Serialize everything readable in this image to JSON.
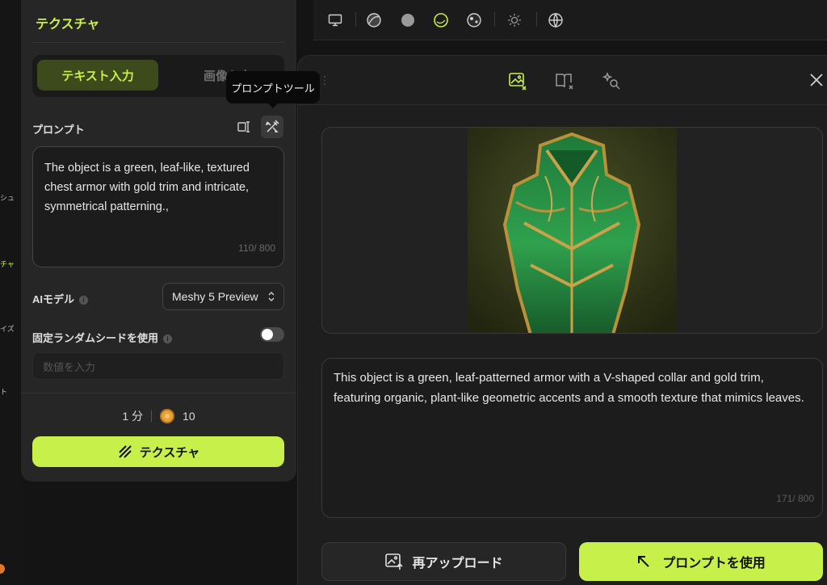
{
  "leftnav": {
    "fragments": [
      {
        "text": "シュ",
        "active": false
      },
      {
        "text": "チャ",
        "active": true
      },
      {
        "text": "イズ",
        "active": false
      },
      {
        "text": "ト",
        "active": false
      }
    ]
  },
  "panel": {
    "title": "テクスチャ",
    "tabs": [
      {
        "label": "テキスト入力",
        "active": true
      },
      {
        "label": "画像入力",
        "active": false
      }
    ],
    "tooltip": "プロンプトツール",
    "prompt_label": "プロンプト",
    "prompt_text": "The object is a green, leaf-like, textured chest armor with gold trim and intricate, symmetrical patterning.,",
    "prompt_counter": "110/ 800",
    "model_label": "AIモデル",
    "model_value": "Meshy 5 Preview",
    "seed_label": "固定ランダムシードを使用",
    "seed_enabled": false,
    "seed_placeholder": "数値を入力",
    "time_cost": "1 分",
    "credit_cost": "10",
    "submit_label": "テクスチャ"
  },
  "toolbar": {
    "icons": [
      "monitor-icon",
      "matcap-sphere-icon",
      "solid-sphere-icon",
      "wireframe-sphere-icon",
      "textured-sphere-icon",
      "light-icon",
      "globe-icon"
    ]
  },
  "modal": {
    "tabs": [
      {
        "icon": "image-to-text-icon",
        "active": true
      },
      {
        "icon": "book-text-icon",
        "active": false
      },
      {
        "icon": "sparkle-search-icon",
        "active": false
      }
    ],
    "description": "This object is a green, leaf-patterned armor with a V-shaped collar and gold trim, featuring organic, plant-like geometric accents and a smooth texture that mimics leaves.",
    "description_counter": "171/ 800",
    "reupload_label": "再アップロード",
    "use_prompt_label": "プロンプトを使用"
  },
  "colors": {
    "accent": "#c8f04a",
    "background": "#141414",
    "panel": "#262626"
  }
}
